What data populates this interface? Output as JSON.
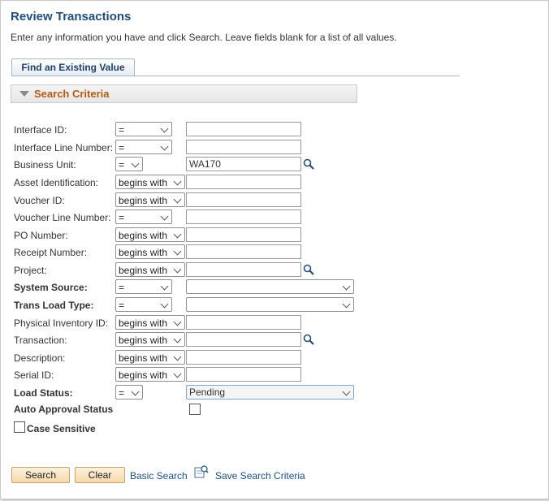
{
  "page": {
    "title": "Review Transactions",
    "instructions": "Enter any information you have and click Search. Leave fields blank for a list of all values."
  },
  "tabs": [
    {
      "label": "Find an Existing Value",
      "active": true
    }
  ],
  "section": {
    "title": "Search Criteria",
    "expanded": true
  },
  "fields": [
    {
      "label": "Interface ID:",
      "bold": false,
      "operator": "=",
      "value": "",
      "lookup": false,
      "dropdown": false
    },
    {
      "label": "Interface Line Number:",
      "bold": false,
      "operator": "=",
      "value": "",
      "lookup": false,
      "dropdown": false
    },
    {
      "label": "Business Unit:",
      "bold": false,
      "operator": "=",
      "value": "WA170",
      "lookup": true,
      "dropdown": false
    },
    {
      "label": "Asset Identification:",
      "bold": false,
      "operator": "begins with",
      "value": "",
      "lookup": false,
      "dropdown": false
    },
    {
      "label": "Voucher ID:",
      "bold": false,
      "operator": "begins with",
      "value": "",
      "lookup": false,
      "dropdown": false
    },
    {
      "label": "Voucher Line Number:",
      "bold": false,
      "operator": "=",
      "value": "",
      "lookup": false,
      "dropdown": false
    },
    {
      "label": "PO Number:",
      "bold": false,
      "operator": "begins with",
      "value": "",
      "lookup": false,
      "dropdown": false
    },
    {
      "label": "Receipt Number:",
      "bold": false,
      "operator": "begins with",
      "value": "",
      "lookup": false,
      "dropdown": false
    },
    {
      "label": "Project:",
      "bold": false,
      "operator": "begins with",
      "value": "",
      "lookup": true,
      "dropdown": false
    },
    {
      "label": "System Source:",
      "bold": true,
      "operator": "=",
      "value": "",
      "lookup": false,
      "dropdown": true
    },
    {
      "label": "Trans Load Type:",
      "bold": true,
      "operator": "=",
      "value": "",
      "lookup": false,
      "dropdown": true
    },
    {
      "label": "Physical Inventory ID:",
      "bold": false,
      "operator": "begins with",
      "value": "",
      "lookup": false,
      "dropdown": false
    },
    {
      "label": "Transaction:",
      "bold": false,
      "operator": "begins with",
      "value": "",
      "lookup": true,
      "dropdown": false
    },
    {
      "label": "Description:",
      "bold": false,
      "operator": "begins with",
      "value": "",
      "lookup": false,
      "dropdown": false
    },
    {
      "label": "Serial ID:",
      "bold": false,
      "operator": "begins with",
      "value": "",
      "lookup": false,
      "dropdown": false
    },
    {
      "label": "Load Status:",
      "bold": true,
      "operator": "=",
      "value": "Pending",
      "lookup": false,
      "dropdown": true
    }
  ],
  "auto_approval": {
    "label": "Auto Approval Status",
    "checked": false
  },
  "case_sensitive": {
    "label": "Case Sensitive",
    "checked": false
  },
  "actions": {
    "search_label": "Search",
    "clear_label": "Clear",
    "basic_search_label": "Basic Search",
    "save_search_label": "Save Search Criteria"
  },
  "icons": {
    "lookup": "magnifier-icon",
    "save_search": "save-search-icon",
    "collapse": "triangle-down-icon"
  },
  "colors": {
    "title": "#1f4e79",
    "section_title": "#b35a13",
    "link": "#1a4f86",
    "button_bg": "#f5d9ac"
  }
}
